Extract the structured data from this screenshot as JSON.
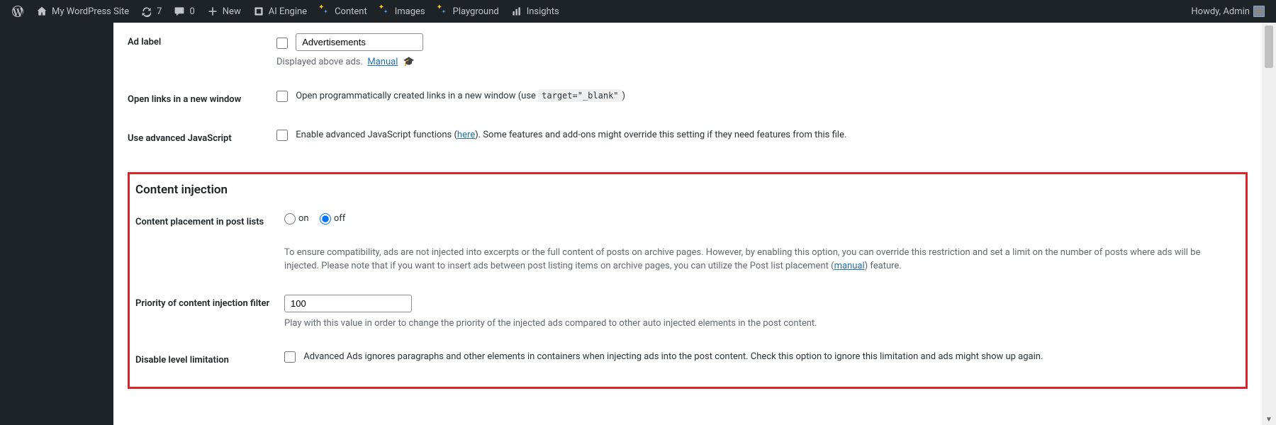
{
  "adminbar": {
    "site": "My WordPress Site",
    "updates": "7",
    "comments": "0",
    "new": "New",
    "ai_engine": "AI Engine",
    "content": "Content",
    "images": "Images",
    "playground": "Playground",
    "insights": "Insights",
    "howdy": "Howdy, Admin"
  },
  "settings": {
    "ad_label": {
      "title": "Ad label",
      "value": "Advertisements",
      "desc_prefix": "Displayed above ads.",
      "manual": "Manual"
    },
    "open_links": {
      "title": "Open links in a new window",
      "desc_before": "Open programmatically created links in a new window (use ",
      "code": "target=\"_blank\"",
      "desc_after": ")"
    },
    "advanced_js": {
      "title": "Use advanced JavaScript",
      "desc_before": "Enable advanced JavaScript functions (",
      "link": "here",
      "desc_after": "). Some features and add-ons might override this setting if they need features from this file."
    },
    "content_injection_heading": "Content injection",
    "placement": {
      "title": "Content placement in post lists",
      "on": "on",
      "off": "off",
      "desc_before": "To ensure compatibility, ads are not injected into excerpts or the full content of posts on archive pages. However, by enabling this option, you can override this restriction and set a limit on the number of posts where ads will be injected. Please note that if you want to insert ads between post listing items on archive pages, you can utilize the Post list placement (",
      "link": "manual",
      "desc_after": ") feature."
    },
    "priority": {
      "title": "Priority of content injection filter",
      "value": "100",
      "desc": "Play with this value in order to change the priority of the injected ads compared to other auto injected elements in the post content."
    },
    "disable_level": {
      "title": "Disable level limitation",
      "desc": "Advanced Ads ignores paragraphs and other elements in containers when injecting ads into the post content. Check this option to ignore this limitation and ads might show up again."
    }
  }
}
